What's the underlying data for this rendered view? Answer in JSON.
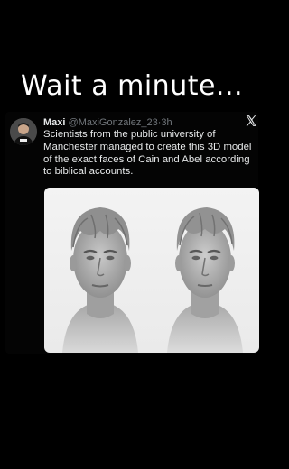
{
  "caption": "Wait a minute...",
  "tweet": {
    "display_name": "Maxi",
    "handle": "@MaxiGonzalez_23",
    "separator": "·",
    "time": "3h",
    "text": "Scientists from the public university of Manchester managed to create this 3D model of the exact faces of Cain and Abel according to biblical accounts.",
    "platform_icon": "x-logo-icon"
  },
  "media": {
    "icon": "two-3d-face-busts",
    "background": "#efefef"
  }
}
